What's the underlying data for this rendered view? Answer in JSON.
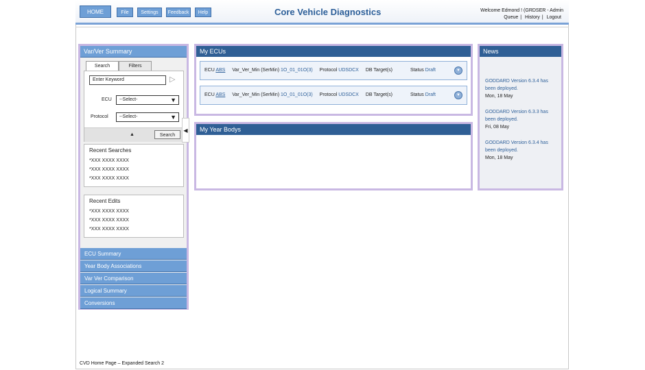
{
  "header": {
    "nav": [
      "HOME",
      "File",
      "Settings",
      "Feedback",
      "Help"
    ],
    "title": "Core Vehicle Diagnostics",
    "welcome": "Welcome Edmond !  (GRDSER - Admin",
    "links": [
      "Queue",
      "History",
      "Logout"
    ]
  },
  "left": {
    "title": "Var/Ver Summary",
    "tabs": [
      "Search",
      "Filters"
    ],
    "keyword_placeholder": "Enter Keyword",
    "ecu_label": "ECU",
    "ecu_value": "--Select-",
    "protocol_label": "Protocol",
    "protocol_value": "--Select-",
    "search_button": "Search",
    "recent_searches": {
      "title": "Recent Searches",
      "items": [
        "*XXX XXXX XXXX",
        "*XXX XXXX XXXX",
        "*XXX XXXX XXXX"
      ]
    },
    "recent_edits": {
      "title": "Recent Edits",
      "items": [
        "*XXX XXXX XXXX",
        "*XXX XXXX XXXX",
        "*XXX XXXX XXXX"
      ]
    },
    "nav": [
      "ECU Summary",
      "Year Body Associations",
      "Var Ver Comparison",
      "Logical Summary",
      "Conversions"
    ]
  },
  "ecus": {
    "title": "My ECUs",
    "rows": [
      {
        "ecu_label": "ECU",
        "ecu": "ABS",
        "var_label": "Var_Ver_Min (SerMin)",
        "var": "1O_01_01O(3)",
        "protocol_label": "Protocol",
        "protocol": "UDSDCX",
        "db_label": "DB Target(s)",
        "status_label": "Status",
        "status": "Draft"
      },
      {
        "ecu_label": "ECU",
        "ecu": "ABS",
        "var_label": "Var_Ver_Min (SerMin)",
        "var": "1O_01_01O(3)",
        "protocol_label": "Protocol",
        "protocol": "UDSDCX",
        "db_label": "DB Target(s)",
        "status_label": "Status",
        "status": "Draft"
      }
    ]
  },
  "years": {
    "title": "My Year Bodys"
  },
  "news": {
    "title": "News",
    "items": [
      {
        "text": "GODDARD Version 6.3.4 has been deployed.",
        "date": "Mon, 18 May"
      },
      {
        "text": "GODDARD Version 6.3.3 has been deployed.",
        "date": "Fri, 08 May"
      },
      {
        "text": "GODDARD Version 6.3.4 has been deployed.",
        "date": "Mon, 18 May"
      }
    ]
  },
  "footer": "CVD Home Page – Expanded Search 2"
}
